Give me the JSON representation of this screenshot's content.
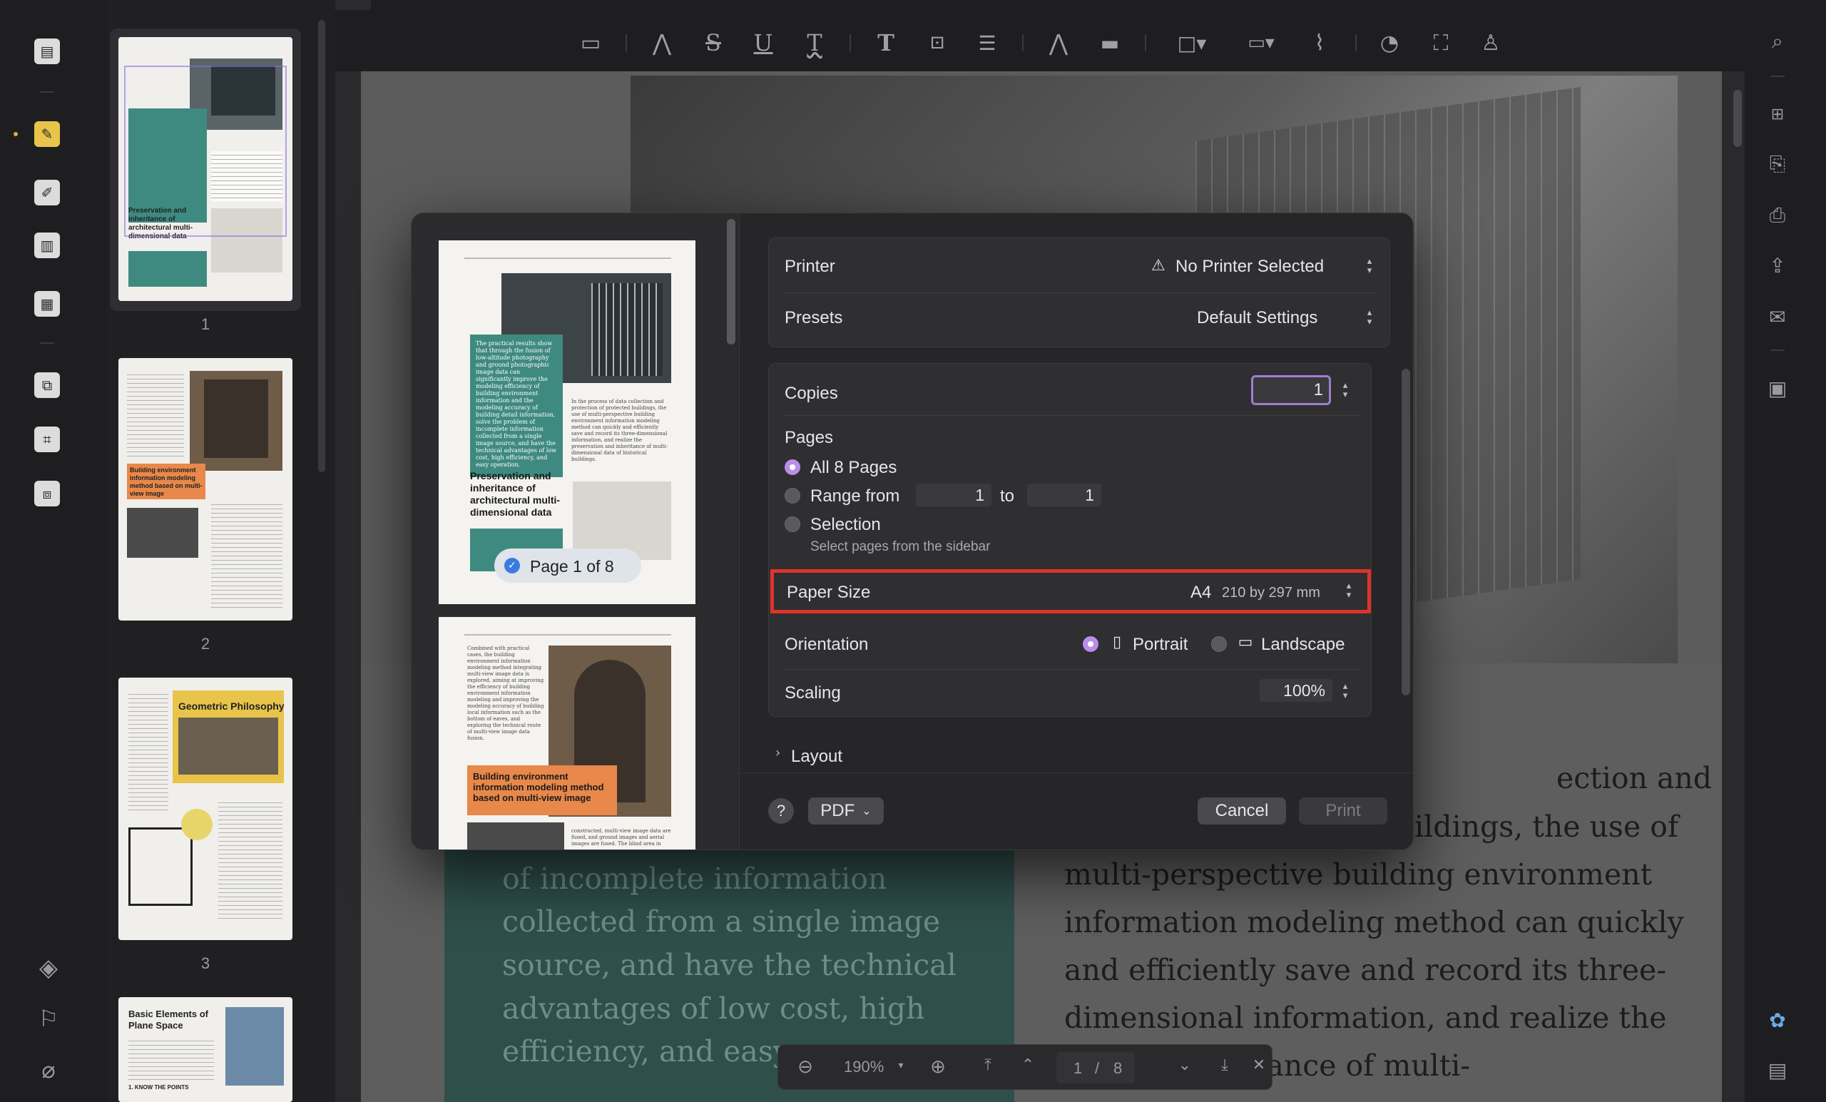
{
  "document": {
    "heading_partial": "ection and",
    "body_lines": [
      "ildings, the use of",
      "multi-perspective building environment",
      "information modeling method can quickly",
      "and efficiently save and record its three-",
      "dimensional information, and realize the",
      "inheritance of multi-"
    ],
    "teal_lines": [
      "of incomplete information",
      "collected from a single image",
      "source, and have the technical",
      "advantages of low cost, high",
      "efficiency, and easy"
    ]
  },
  "thumbnails": [
    {
      "number": "1",
      "title": "Preservation and inheritance of architectural multi-dimensional data"
    },
    {
      "number": "2",
      "title": "Building environment information modeling method based on multi-view image"
    },
    {
      "number": "3",
      "title": "Geometric Philosophy"
    },
    {
      "number": "",
      "title": "Basic Elements of Plane Space",
      "subtitle": "1. KNOW THE POINTS"
    }
  ],
  "bottom_bar": {
    "zoom": "190%",
    "current_page": "1",
    "separator": "/",
    "total_pages": "8"
  },
  "print_dialog": {
    "preview": {
      "page_badge": "Page 1 of 8",
      "page1_title": "Preservation and inheritance of architectural multi-dimensional data",
      "page1_teal_text": "The practical results show that through the fusion of low-altitude photography and ground photographic image data can significantly improve the modeling efficiency of building environment information and the modeling accuracy of building detail information, solve the problem of incomplete information collected from a single image source, and have the technical advantages of low cost, high efficiency, and easy operation.",
      "page1_right_text": "In the process of data collection and protection of protected buildings, the use of multi-perspective building environment information modeling method can quickly and efficiently save and record its three-dimensional information, and realize the preservation and inheritance of multi-dimensional data of historical buildings.",
      "page2_left_text": "Combined with practical cases, the building environment information modeling method integrating multi-view image data is explored, aiming at improving the efficiency of building environment information modeling and improving the modeling accuracy of building local information such as the bottom of eaves, and exploring the technical route of multi-view image data fusion.",
      "page2_orange_title": "Building environment information modeling method based on multi-view image",
      "page2_right_text": "constructed, multi-view image data are fused, and ground images and aerial images are fused. The blind area in"
    },
    "printer_label": "Printer",
    "printer_value": "No Printer Selected",
    "presets_label": "Presets",
    "presets_value": "Default Settings",
    "copies_label": "Copies",
    "copies_value": "1",
    "pages_label": "Pages",
    "all_pages_label": "All 8 Pages",
    "range_from_label": "Range from",
    "range_from_value": "1",
    "range_to_label": "to",
    "range_to_value": "1",
    "selection_label": "Selection",
    "selection_hint": "Select pages from the sidebar",
    "paper_size_label": "Paper Size",
    "paper_size_name": "A4",
    "paper_size_dims": "210 by 297 mm",
    "orientation_label": "Orientation",
    "portrait_label": "Portrait",
    "landscape_label": "Landscape",
    "scaling_label": "Scaling",
    "scaling_value": "100%",
    "layout_label": "Layout",
    "help_label": "?",
    "pdf_label": "PDF",
    "cancel_label": "Cancel",
    "print_label": "Print"
  },
  "colors": {
    "accent_purple": "#b98ee8",
    "highlight_red": "#e0332a",
    "teal": "#3f8a80",
    "orange": "#e8884a",
    "page_bg": "#f4f3ef"
  }
}
